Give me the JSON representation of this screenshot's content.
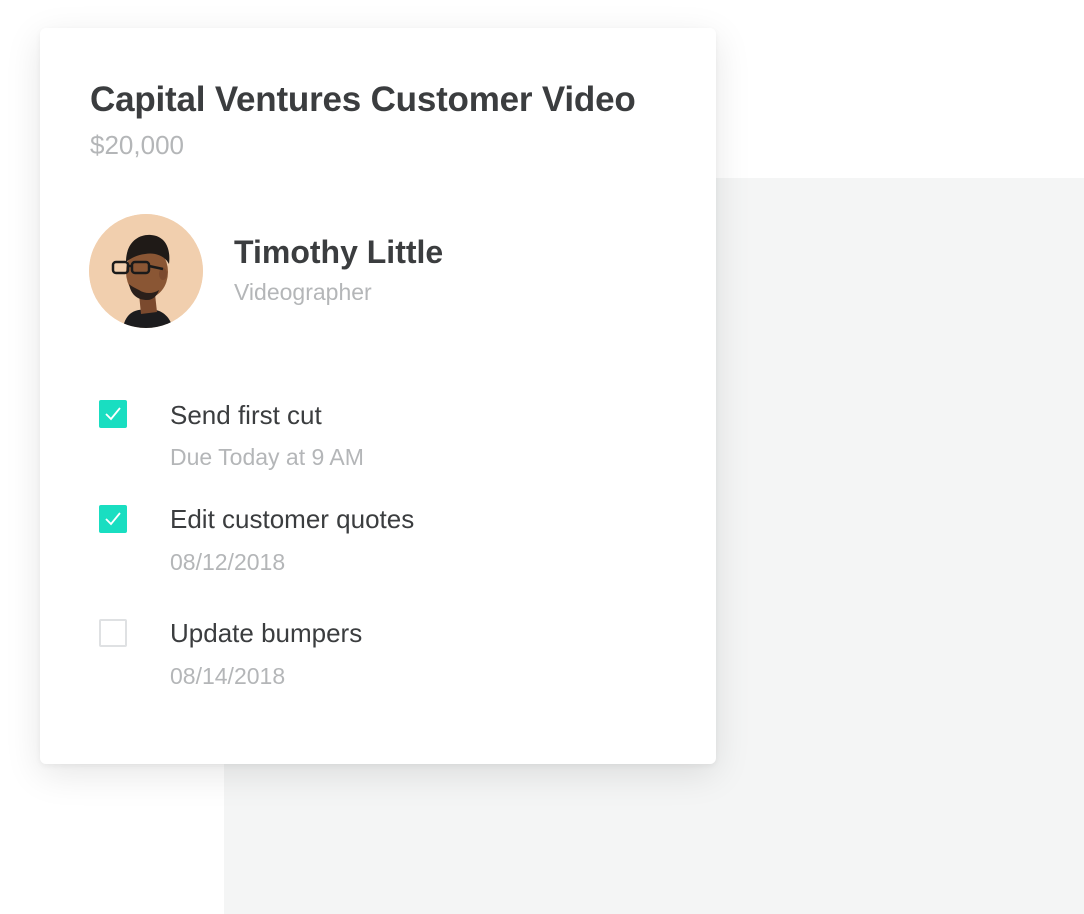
{
  "card": {
    "title": "Capital Ventures Customer Video",
    "amount": "$20,000"
  },
  "assignee": {
    "name": "Timothy Little",
    "role": "Videographer",
    "avatar_bg": "#f1cfae"
  },
  "tasks": [
    {
      "label": "Send first cut",
      "due": "Due Today at 9 AM",
      "checked": true
    },
    {
      "label": "Edit customer quotes",
      "due": "08/12/2018",
      "checked": true
    },
    {
      "label": "Update bumpers",
      "due": "08/14/2018",
      "checked": false
    }
  ],
  "colors": {
    "accent": "#19dec1",
    "text_primary": "#3b3d3f",
    "text_secondary": "#b4b6b8",
    "background_panel": "#f4f5f5"
  },
  "icons": {
    "check": "check-icon",
    "avatar": "person-avatar-icon"
  }
}
